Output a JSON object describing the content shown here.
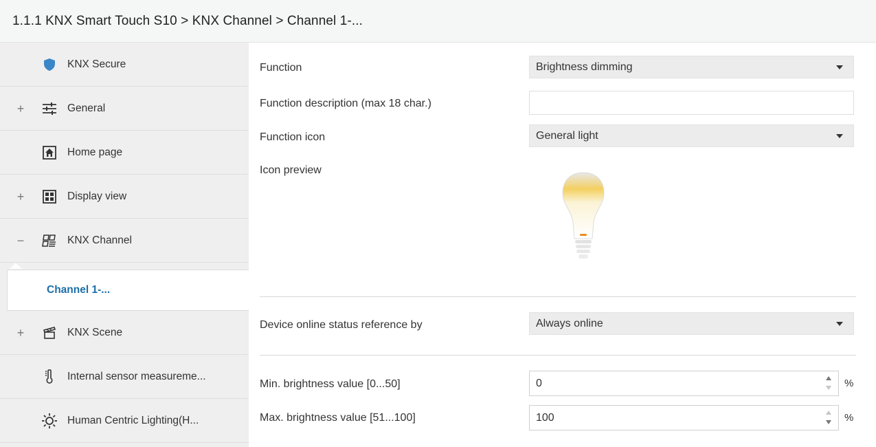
{
  "breadcrumb": "1.1.1 KNX Smart Touch S10 > KNX Channel  > Channel 1-...",
  "sidebar": {
    "items": [
      {
        "label": "KNX Secure",
        "icon": "shield-icon",
        "expander": ""
      },
      {
        "label": "General",
        "icon": "sliders-icon",
        "expander": "+"
      },
      {
        "label": "Home page",
        "icon": "home-icon",
        "expander": ""
      },
      {
        "label": "Display view",
        "icon": "grid-icon",
        "expander": "+"
      },
      {
        "label": "KNX Channel",
        "icon": "channel-icon",
        "expander": "−"
      },
      {
        "label": "Channel 1-...",
        "icon": "",
        "expander": ""
      },
      {
        "label": "KNX Scene",
        "icon": "scene-icon",
        "expander": "+"
      },
      {
        "label": "Internal sensor measureme...",
        "icon": "thermometer-icon",
        "expander": ""
      },
      {
        "label": "Human Centric Lighting(H...",
        "icon": "sun-icon",
        "expander": ""
      }
    ],
    "selected_index": 5
  },
  "form": {
    "function": {
      "label": "Function",
      "value": "Brightness dimming"
    },
    "description": {
      "label": "Function description (max 18 char.)",
      "value": ""
    },
    "icon": {
      "label": "Function icon",
      "value": "General light"
    },
    "preview": {
      "label": "Icon preview",
      "icon": "light-bulb-icon"
    },
    "online_status": {
      "label": "Device online status reference by",
      "value": "Always online"
    },
    "min_brightness": {
      "label": "Min. brightness value [0...50]",
      "value": "0",
      "unit": "%"
    },
    "max_brightness": {
      "label": "Max. brightness value [51...100]",
      "value": "100",
      "unit": "%"
    }
  },
  "colors": {
    "accent": "#1c6ea8",
    "shield": "#3a86c8",
    "bulb_glow": "#f4d060"
  }
}
